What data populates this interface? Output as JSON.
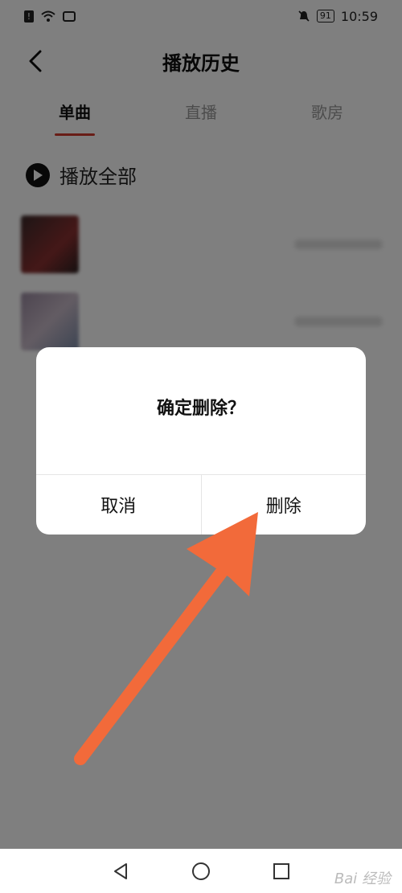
{
  "status_bar": {
    "time": "10:59",
    "battery": "91"
  },
  "header": {
    "title": "播放历史"
  },
  "tabs": [
    {
      "label": "单曲",
      "active": true
    },
    {
      "label": "直播",
      "active": false
    },
    {
      "label": "歌房",
      "active": false
    }
  ],
  "play_all": {
    "label": "播放全部"
  },
  "songs": [
    {
      "title": "",
      "subtitle": ""
    },
    {
      "title": "",
      "subtitle": ""
    }
  ],
  "dialog": {
    "title": "确定删除？",
    "cancel_label": "取消",
    "confirm_label": "删除"
  },
  "annotation": {
    "color": "#f26a3a"
  },
  "watermark": "Bai 经验",
  "colors": {
    "accent": "#d23b2f",
    "overlay": "rgba(0,0,0,0.5)"
  }
}
